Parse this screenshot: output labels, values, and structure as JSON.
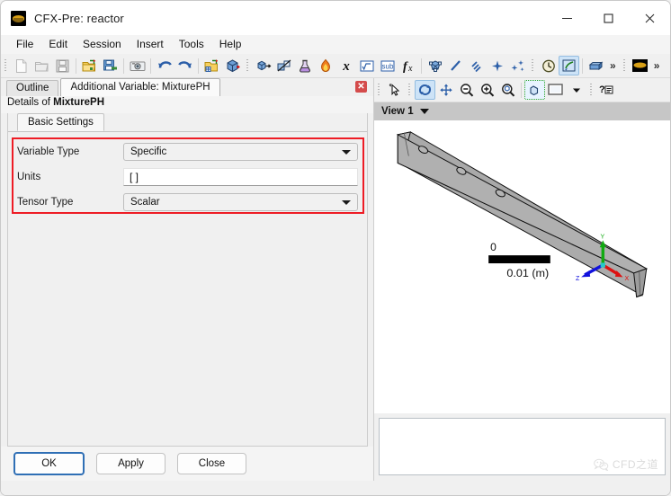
{
  "window": {
    "title": "CFX-Pre:  reactor",
    "app_icon": "cfx-logo-icon",
    "controls": {
      "minimize": "minimize-icon",
      "maximize": "maximize-icon",
      "close": "close-icon"
    }
  },
  "menu": {
    "items": [
      {
        "label": "File"
      },
      {
        "label": "Edit"
      },
      {
        "label": "Session"
      },
      {
        "label": "Insert"
      },
      {
        "label": "Tools"
      },
      {
        "label": "Help"
      }
    ]
  },
  "toolbar": {
    "groups": [
      {
        "name": "file-group",
        "items": [
          {
            "icon": "new-document-icon",
            "disabled": true
          },
          {
            "icon": "open-folder-icon",
            "disabled": true
          },
          {
            "icon": "save-icon",
            "disabled": true
          }
        ]
      },
      {
        "name": "import-export-group",
        "items": [
          {
            "icon": "import-mesh-icon"
          },
          {
            "icon": "export-mesh-icon"
          }
        ]
      },
      {
        "name": "capture-group",
        "items": [
          {
            "icon": "camera-snapshot-icon"
          }
        ]
      },
      {
        "name": "history-group",
        "items": [
          {
            "icon": "undo-icon"
          },
          {
            "icon": "redo-icon"
          }
        ]
      },
      {
        "name": "mesh-group",
        "items": [
          {
            "icon": "import-mesh-grid-icon"
          },
          {
            "icon": "mesh-cube-icon"
          }
        ]
      },
      {
        "name": "physics-group",
        "items": [
          {
            "icon": "domain-icon"
          },
          {
            "icon": "domain-interface-icon"
          },
          {
            "icon": "material-flask-icon"
          },
          {
            "icon": "reaction-flame-icon"
          },
          {
            "icon": "expression-icon"
          },
          {
            "icon": "variable-sqrt-icon"
          },
          {
            "icon": "subdomain-icon"
          },
          {
            "icon": "function-fx-icon"
          }
        ]
      },
      {
        "name": "region-group",
        "items": [
          {
            "icon": "mesh-region-icon"
          },
          {
            "icon": "line-icon"
          },
          {
            "icon": "streamline-icon"
          },
          {
            "icon": "point-icon"
          },
          {
            "icon": "particle-icon"
          }
        ]
      },
      {
        "name": "solver-group",
        "items": [
          {
            "icon": "timestep-clock-icon"
          },
          {
            "icon": "solver-control-icon",
            "active": true
          },
          {
            "icon": "define-run-box-icon"
          }
        ],
        "overflow": "»"
      },
      {
        "name": "cfx-group",
        "items": [
          {
            "icon": "cfx-logo-icon"
          }
        ],
        "overflow": "»"
      }
    ]
  },
  "tabs": {
    "items": [
      {
        "label": "Outline",
        "selected": false
      },
      {
        "label": "Additional Variable: MixturePH",
        "selected": true
      }
    ],
    "close_icon": "✕"
  },
  "details": {
    "prefix": "Details of ",
    "object_name": "MixturePH"
  },
  "sub_tabs": {
    "items": [
      {
        "label": "Basic Settings",
        "selected": true
      }
    ]
  },
  "form": {
    "rows": [
      {
        "label": "Variable Type",
        "control": "dropdown",
        "value": "Specific"
      },
      {
        "label": "Units",
        "control": "text",
        "value": "[ ]"
      },
      {
        "label": "Tensor Type",
        "control": "dropdown",
        "value": "Scalar"
      }
    ],
    "highlight_color": "#ee1c25"
  },
  "buttons": {
    "ok": "OK",
    "apply": "Apply",
    "close": "Close"
  },
  "viewer": {
    "toolbar": [
      {
        "icon": "select-cursor-icon"
      },
      {
        "icon": "rotate-icon",
        "active": true
      },
      {
        "icon": "pan-icon"
      },
      {
        "icon": "zoom-out-icon"
      },
      {
        "icon": "zoom-in-icon"
      },
      {
        "icon": "zoom-box-icon"
      },
      {
        "icon": "fit-view-icon",
        "active": true
      },
      {
        "icon": "background-color-swatch-icon"
      },
      {
        "icon": "chevron-down-icon"
      },
      {
        "icon": "viewer-help-icon"
      }
    ],
    "view_label": "View 1",
    "view_dropdown_icon": "chevron-down-icon",
    "scale": {
      "min": "0",
      "max": "0.01",
      "units": "(m)"
    },
    "axis_triad": {
      "x_label": "X",
      "y_label": "Y",
      "z_label": "Z",
      "x_color": "#dd1111",
      "y_color": "#11aa11",
      "z_color": "#1111dd"
    },
    "geometry": {
      "name": "reactor-duct-geometry",
      "fill": "#aaaaaa",
      "top_fill": "#9f9f9f",
      "side_fill": "#b4b4b4",
      "stroke": "#111111",
      "hole_count": 3
    }
  },
  "watermark": {
    "text": "CFD之道",
    "icon": "wechat-icon"
  }
}
